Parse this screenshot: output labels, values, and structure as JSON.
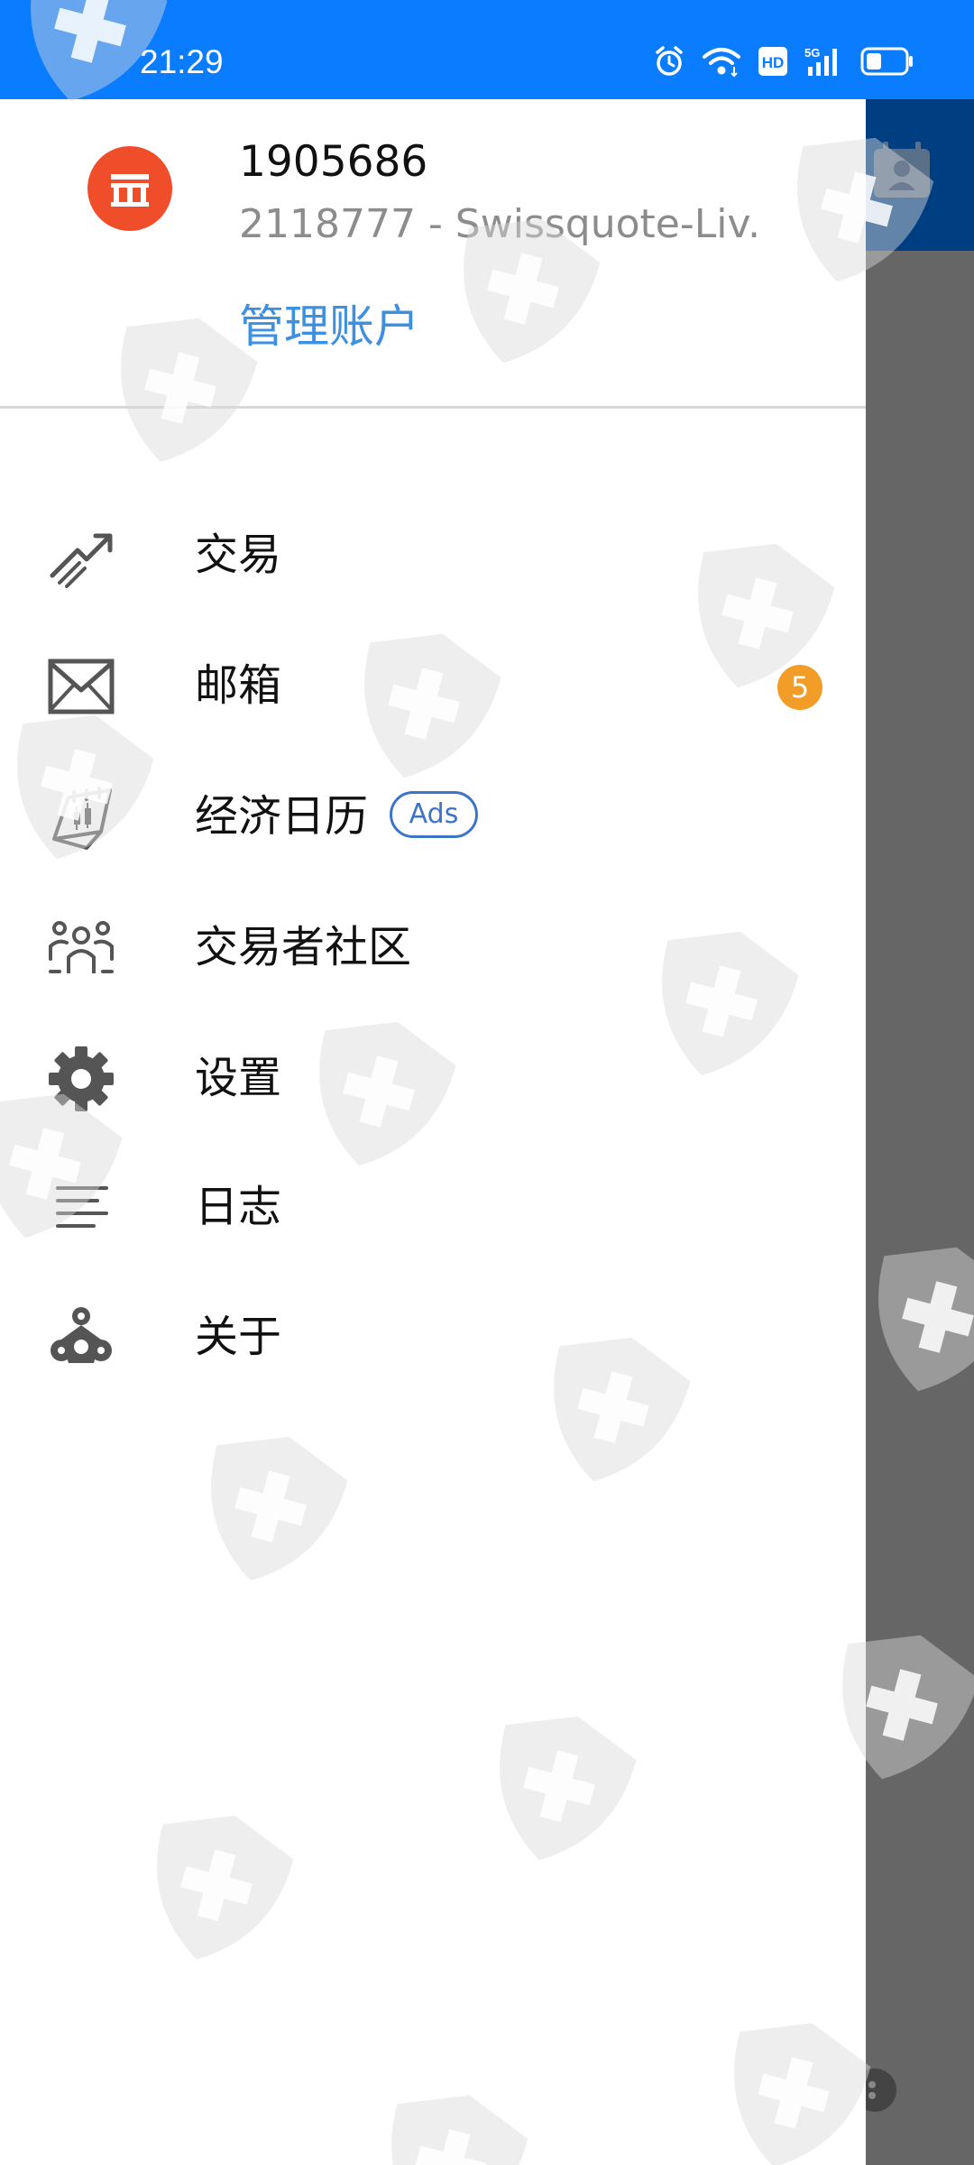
{
  "status_bar": {
    "time": "21:29",
    "icons": [
      "alarm-icon",
      "wifi-icon",
      "hd-icon",
      "signal-5g-icon",
      "battery-icon"
    ]
  },
  "account": {
    "login": "1905686",
    "server": "2118777 - Swissquote-Liv...",
    "manage_label": "管理账户",
    "logo_color": "#f04e2b"
  },
  "menu": {
    "items": [
      {
        "label": "交易",
        "icon": "trade-chart-icon"
      },
      {
        "label": "邮箱",
        "icon": "mail-icon",
        "badge": "5"
      },
      {
        "label": "经济日历",
        "icon": "economic-calendar-icon",
        "tag": "Ads"
      },
      {
        "label": "交易者社区",
        "icon": "community-icon"
      },
      {
        "label": "设置",
        "icon": "gear-icon"
      },
      {
        "label": "日志",
        "icon": "journal-lines-icon"
      },
      {
        "label": "关于",
        "icon": "about-icon"
      }
    ]
  },
  "colors": {
    "status_bar": "#0a7cff",
    "header_dark": "#003e82",
    "accent_link": "#3d8fe0",
    "ads_tag": "#3d74c7",
    "badge": "#f29d27",
    "overlay": "#666666"
  }
}
